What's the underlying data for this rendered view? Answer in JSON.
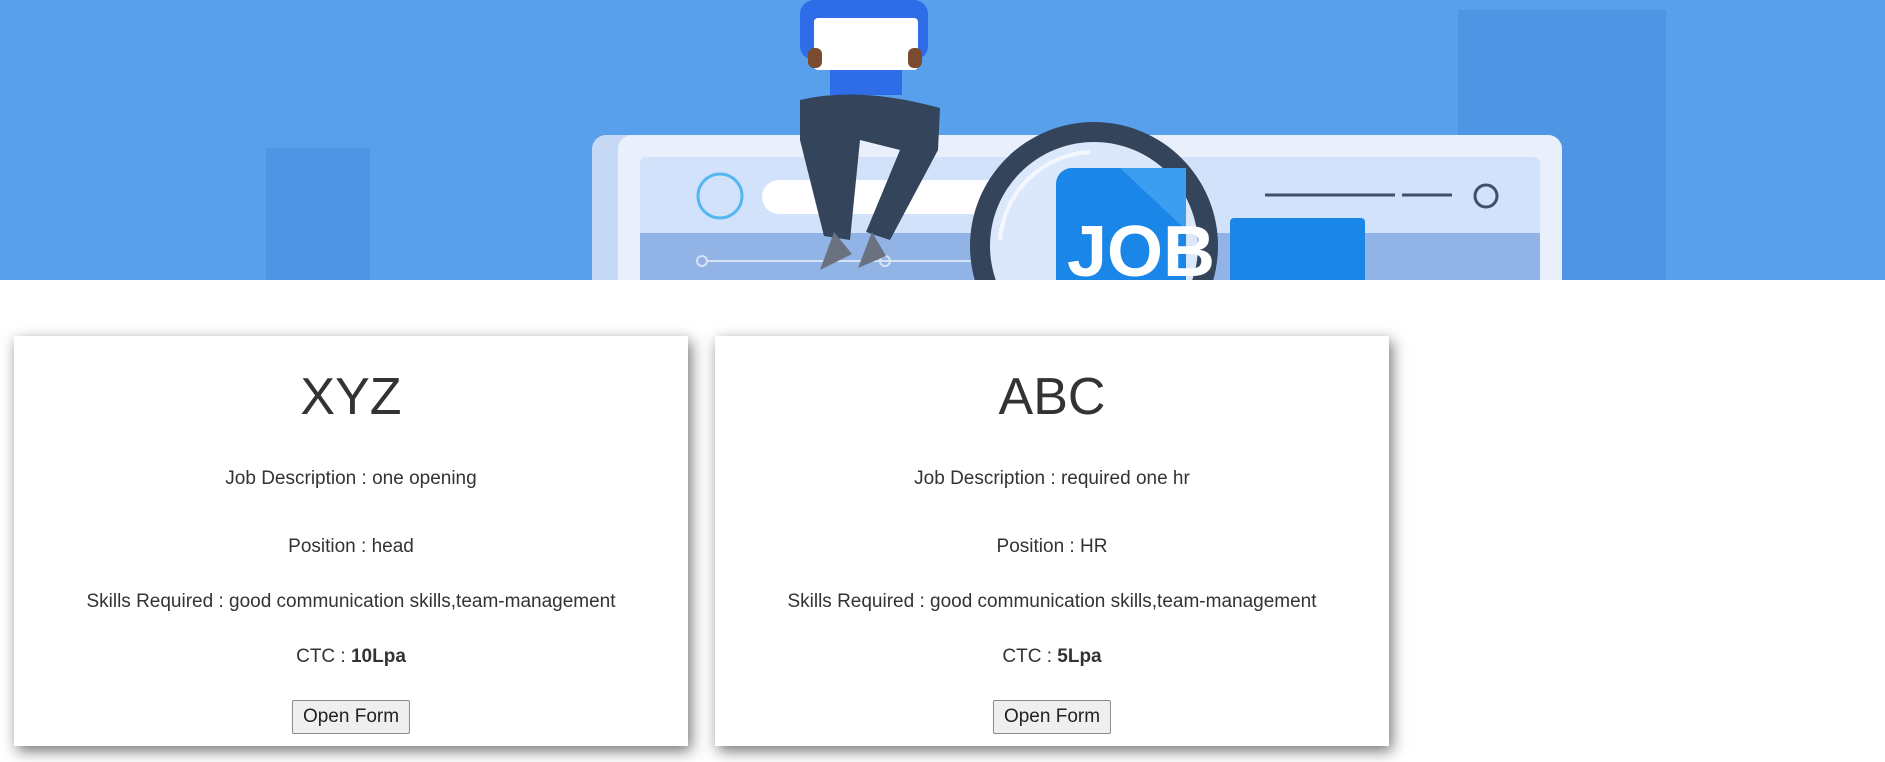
{
  "banner": {
    "badge_text": "JOB",
    "colors": {
      "sky": "#58a0ec",
      "monitor_frame": "#e3ecfa",
      "monitor_screen": "#cfdffa",
      "accent_blue": "#1a86e8",
      "dark": "#34445a"
    }
  },
  "jobs": [
    {
      "company": "XYZ",
      "description_label": "Job Description : ",
      "description": "one opening",
      "position_label": "Position : ",
      "position": "head",
      "skills_label": "Skills Required : ",
      "skills": "good communication skills,team-management",
      "ctc_label": "CTC : ",
      "ctc": "10Lpa",
      "button_label": "Open Form"
    },
    {
      "company": "ABC",
      "description_label": "Job Description : ",
      "description": "required one hr",
      "position_label": "Position : ",
      "position": "HR",
      "skills_label": "Skills Required : ",
      "skills": "good communication skills,team-management",
      "ctc_label": "CTC : ",
      "ctc": "5Lpa",
      "button_label": "Open Form"
    }
  ]
}
